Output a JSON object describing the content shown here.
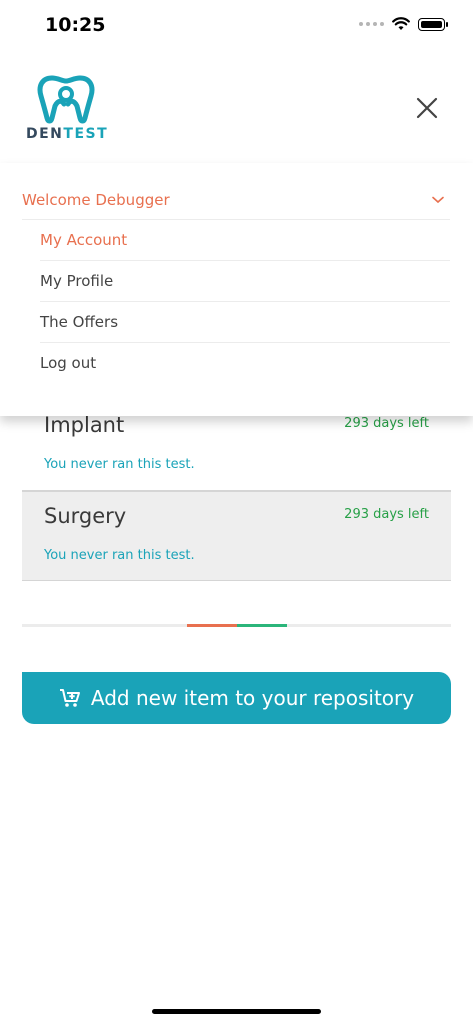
{
  "status": {
    "time": "10:25"
  },
  "header": {
    "logo_den": "DEN",
    "logo_test": "TEST"
  },
  "menu": {
    "welcome": "Welcome Debugger",
    "items": [
      {
        "label": "My Account",
        "active": true
      },
      {
        "label": "My Profile",
        "active": false
      },
      {
        "label": "The Offers",
        "active": false
      },
      {
        "label": "Log out",
        "active": false
      }
    ]
  },
  "tests": [
    {
      "title": "Implant",
      "days_left": "293 days left",
      "note": "You never ran this test."
    },
    {
      "title": "Surgery",
      "days_left": "293 days left",
      "note": "You never ran this test."
    }
  ],
  "add_button": {
    "label": "Add new item to your repository",
    "icon": "cart-plus-icon"
  },
  "colors": {
    "accent": "#1aa3b8",
    "orange": "#e8704f",
    "green": "#27a047"
  }
}
